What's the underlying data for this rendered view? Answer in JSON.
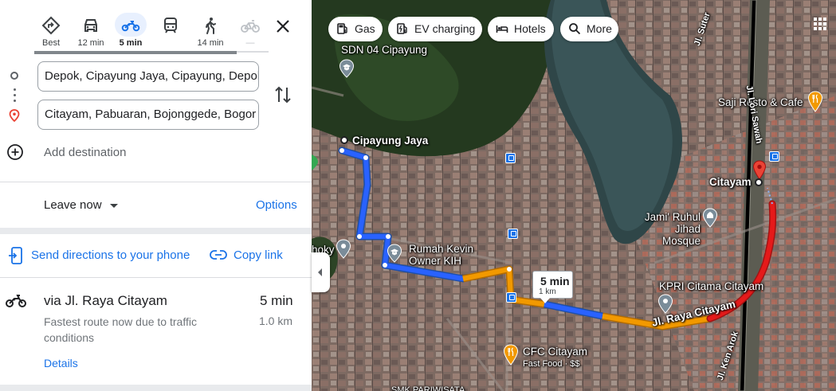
{
  "modes": {
    "best": {
      "label": "Best"
    },
    "driving": {
      "label": "12 min"
    },
    "two_wheeler": {
      "label": "5 min"
    },
    "transit": {
      "label": ""
    },
    "walking": {
      "label": "14 min"
    },
    "cycling": {
      "label": "—"
    }
  },
  "origin": {
    "value": "Depok, Cipayung Jaya, Cipayung, Depok C",
    "fade": "ity"
  },
  "destination": {
    "value": "Citayam, Pabuaran, Bojonggede, Bogor Re",
    "fade": "gency"
  },
  "add_destination": "Add destination",
  "leave_now": "Leave now",
  "options": "Options",
  "send_to_phone": "Send directions to your phone",
  "copy_link": "Copy link",
  "route": {
    "via": "via Jl. Raya Citayam",
    "time": "5 min",
    "description": "Fastest route now due to traffic conditions",
    "distance": "1.0 km",
    "details": "Details"
  },
  "chips": {
    "gas": "Gas",
    "ev": "EV charging",
    "hotels": "Hotels",
    "more": "More"
  },
  "map_labels": {
    "sdn": "SDN 04 Cipayung",
    "cipayung_jaya": "Cipayung Jaya",
    "rumah_kevin": "Rumah Kevin\nOwner KIH",
    "saji": "Saji Resto & Cafe",
    "citayam": "Citayam",
    "mosque": "Jami' Ruhul\nJihad Mosque",
    "kpri": "KPRI Citama Citayam",
    "jl_raya": "Jl. Raya Citayam",
    "cfc": "CFC Citayam",
    "cfc_sub": "Fast Food · $$",
    "smk": "SMK PARIWISATA",
    "jl_ken_arok": "Jl. Ken Arok",
    "jl_suter": "Jl. Suter",
    "jl_lori": "Jl. Lori Sawah",
    "hoky": "hoky"
  },
  "callout": {
    "time": "5 min",
    "distance": "1 km"
  },
  "colors": {
    "accent": "#1a73e8",
    "route_fast": "#1967d2",
    "route_slow": "#f29900",
    "route_heavy": "#e51a1a",
    "pin_red": "#ea4335"
  }
}
